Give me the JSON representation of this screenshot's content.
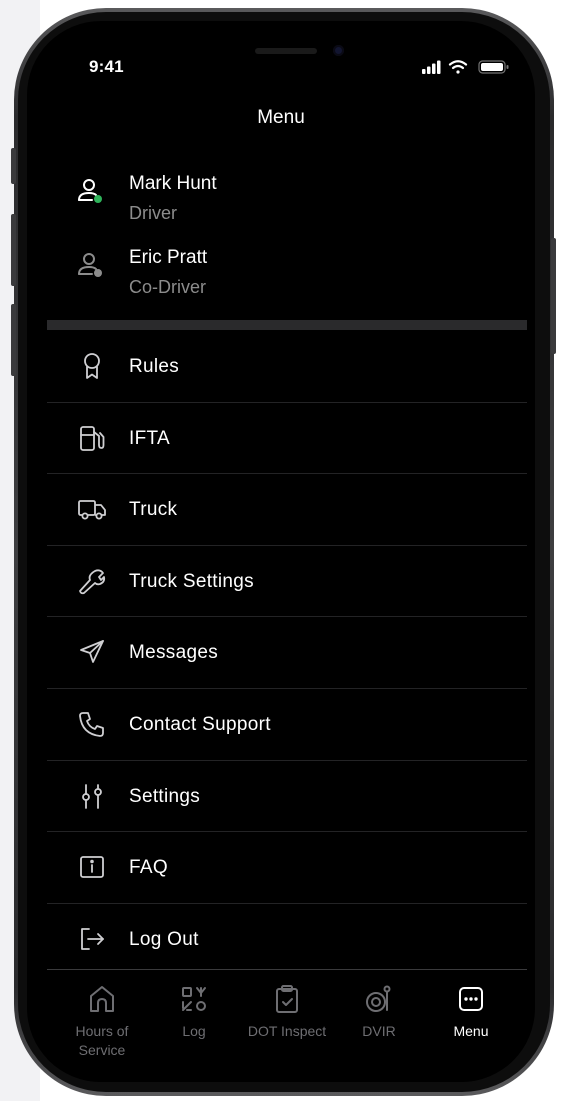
{
  "status_bar": {
    "time": "9:41",
    "icons": [
      "cellular-signal-icon",
      "wifi-icon",
      "battery-icon"
    ]
  },
  "header": {
    "title": "Menu"
  },
  "users": [
    {
      "name": "Mark Hunt",
      "role": "Driver",
      "icon": "user-online-icon",
      "status_color": "#2fb35a"
    },
    {
      "name": "Eric Pratt",
      "role": "Co-Driver",
      "icon": "user-offline-icon",
      "status_color": "#8c8c8c"
    }
  ],
  "menu": {
    "items": [
      {
        "label": "Rules",
        "icon": "ribbon-icon"
      },
      {
        "label": "IFTA",
        "icon": "fuel-pump-icon"
      },
      {
        "label": "Truck",
        "icon": "truck-icon"
      },
      {
        "label": "Truck Settings",
        "icon": "wrench-icon"
      },
      {
        "label": "Messages",
        "icon": "send-icon"
      },
      {
        "label": "Contact Support",
        "icon": "phone-icon"
      },
      {
        "label": "Settings",
        "icon": "sliders-icon"
      },
      {
        "label": "FAQ",
        "icon": "info-icon"
      },
      {
        "label": "Log Out",
        "icon": "logout-icon"
      }
    ]
  },
  "tabbar": {
    "tabs": [
      {
        "label": "Hours of Service",
        "icon": "home-icon",
        "active": false
      },
      {
        "label": "Log",
        "icon": "log-icon",
        "active": false
      },
      {
        "label": "DOT Inspect",
        "icon": "clipboard-check-icon",
        "active": false
      },
      {
        "label": "DVIR",
        "icon": "tire-icon",
        "active": false
      },
      {
        "label": "Menu",
        "icon": "more-icon",
        "active": true
      }
    ]
  },
  "colors": {
    "background": "#000000",
    "text": "#ffffff",
    "muted_text": "#8c8c8c",
    "inactive_tab": "#6e6e72",
    "online": "#2fb35a"
  }
}
